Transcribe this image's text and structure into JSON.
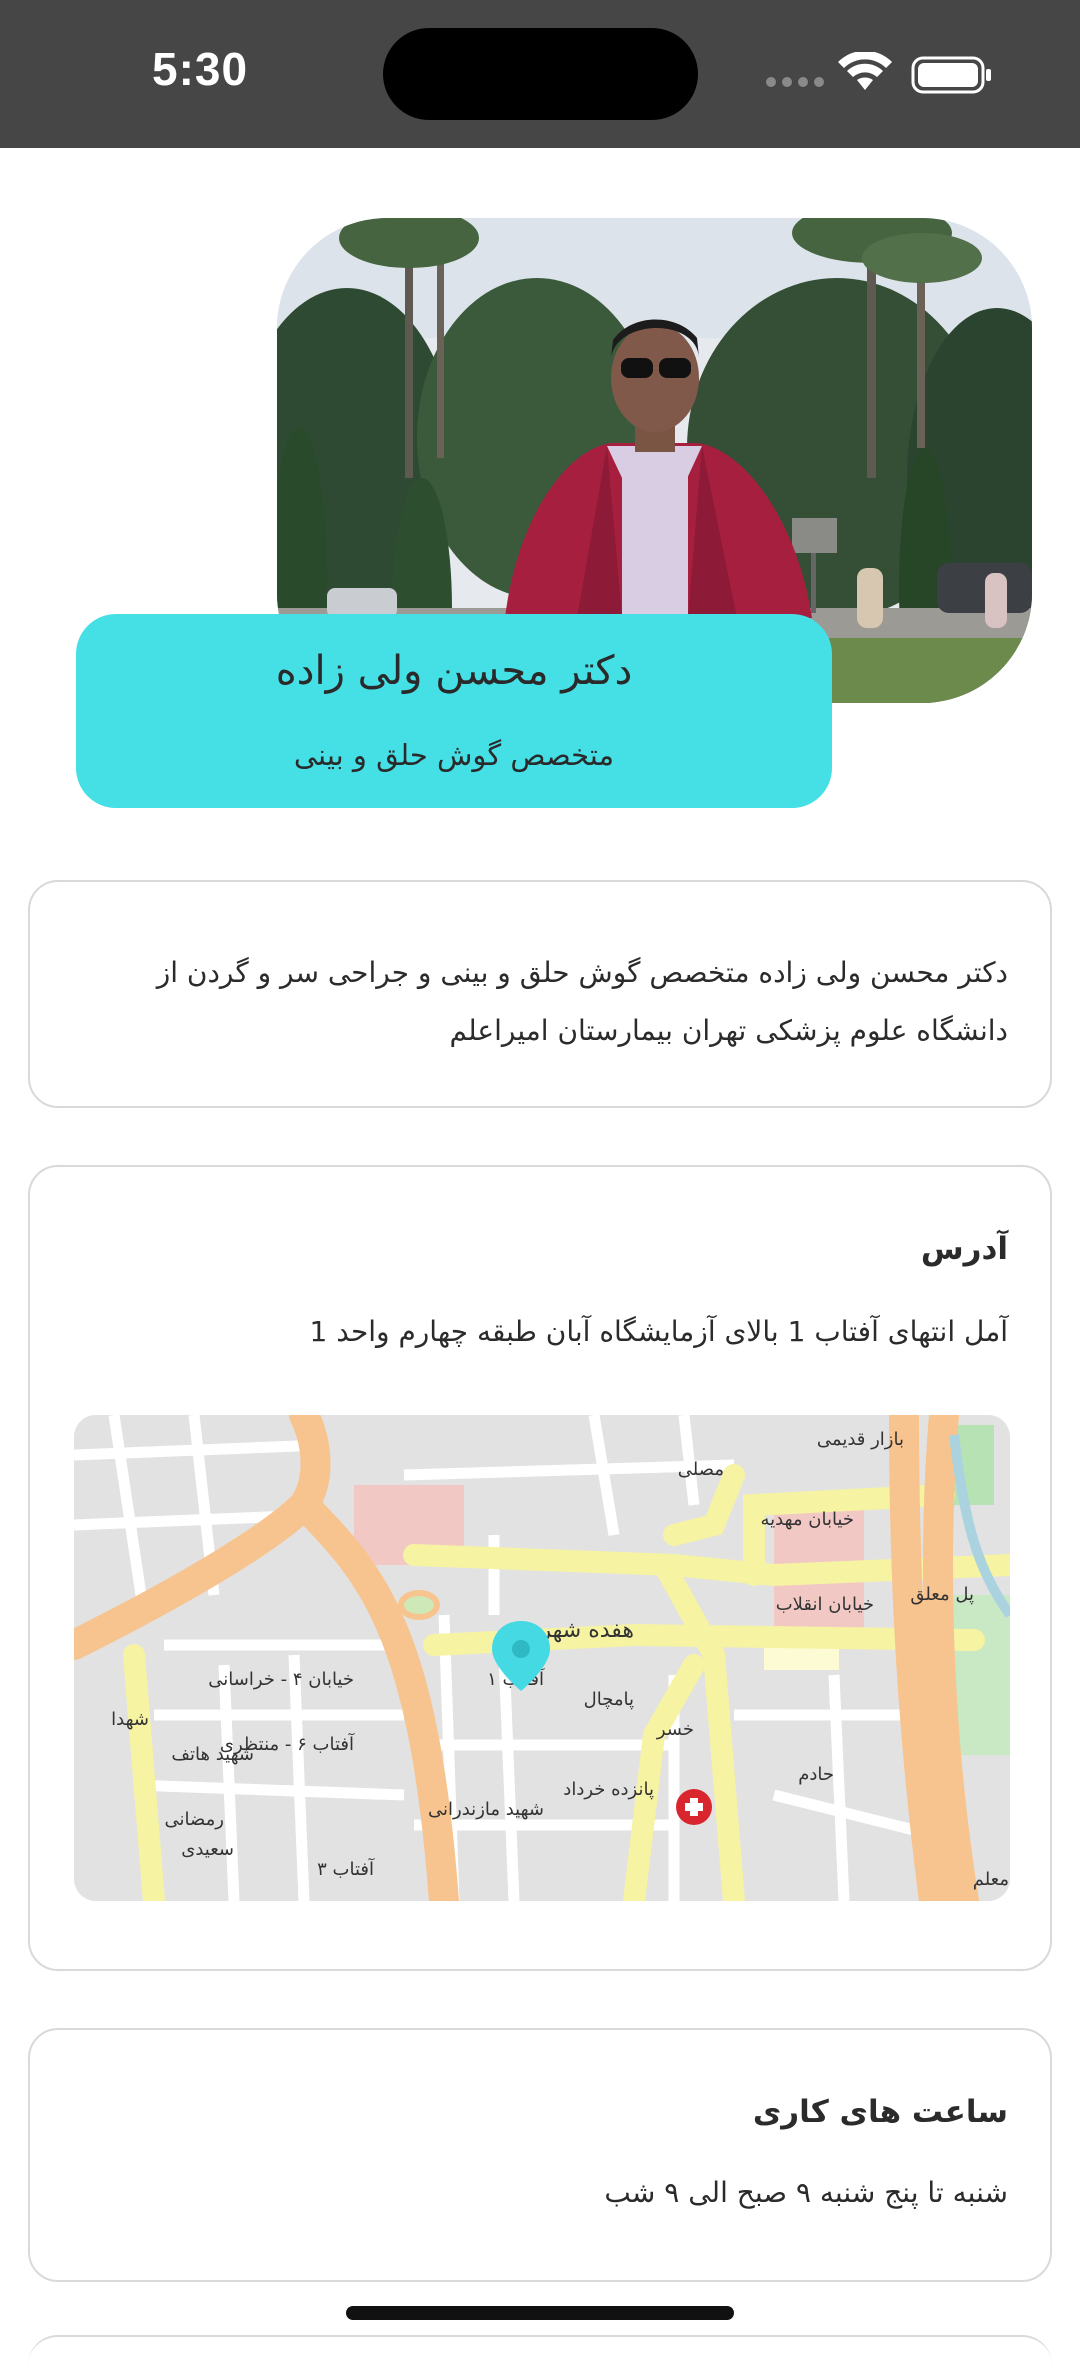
{
  "status_bar": {
    "time": "5:30"
  },
  "profile": {
    "name": "دکتر محسن ولی زاده",
    "specialty": "متخصص گوش حلق و بینی"
  },
  "bio": {
    "text": "دکتر محسن ولی زاده متخصص گوش حلق و بینی و جراحی سر و گردن از دانشگاه علوم پزشکی تهران بیمارستان امیراعلم"
  },
  "address": {
    "title": "آدرس",
    "text": "آمل انتهای آفتاب 1 بالای آزمایشگاه آبان طبقه چهارم واحد 1",
    "map": {
      "labels": {
        "street_1": "هفده شهریور",
        "street_2": "خیابان مهدیه",
        "street_3": "خیابان انقلاب",
        "street_4": "پل معلق",
        "street_5": "خیابان ۴ - خراسانی",
        "street_6": "آفتاب ۶ - منتظری",
        "street_7": "شهید هاتف",
        "street_8": "شهید مازندرانی",
        "street_9": "پانزده خرداد",
        "street_10": "مصلی",
        "street_11": "حادم",
        "street_12": "خسر",
        "street_13": "پامچال",
        "street_14": "رمضانی",
        "street_15": "سعیدی",
        "street_16": "آفتاب ۱",
        "street_17": "آفتاب ۳",
        "street_18": "معلم",
        "street_19": "شهدا",
        "street_20": "بازار قدیمی"
      }
    }
  },
  "hours": {
    "title": "ساعت های کاری",
    "text": "شنبه تا پنج شنبه ۹ صبح الی ۹ شب"
  }
}
